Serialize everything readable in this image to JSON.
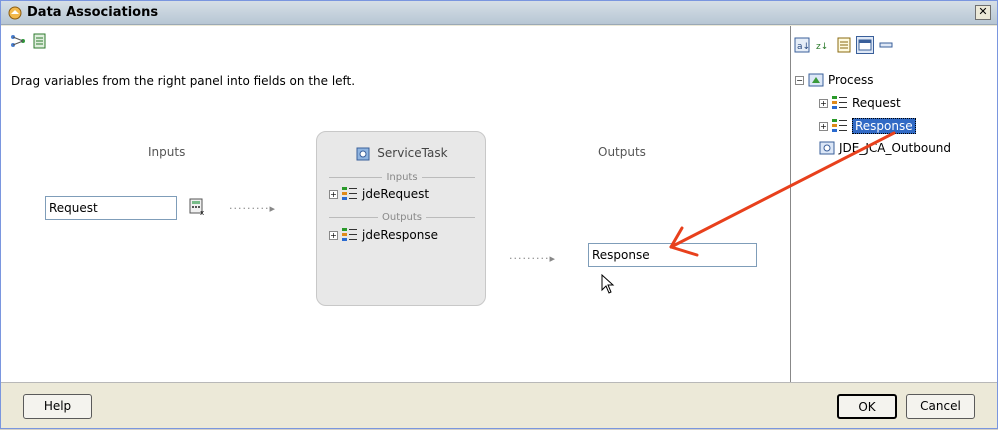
{
  "window": {
    "title": "Data Associations",
    "close_label": "✕"
  },
  "instructions": "Drag variables from the right panel into fields on the left.",
  "columns": {
    "inputs": "Inputs",
    "outputs": "Outputs"
  },
  "inputs": {
    "field_value": "Request"
  },
  "outputs": {
    "field_value": "Response"
  },
  "service_task": {
    "title": "ServiceTask",
    "inputs_section": "Inputs",
    "outputs_section": "Outputs",
    "input_item": "jdeRequest",
    "output_item": "jdeResponse"
  },
  "tree": {
    "root": "Process",
    "children": [
      "Request",
      "Response"
    ],
    "sibling": "JDE_JCA_Outbound"
  },
  "buttons": {
    "help": "Help",
    "ok": "OK",
    "cancel": "Cancel"
  },
  "colors": {
    "selection": "#316ac5",
    "arrow": "#e8401c",
    "panel_bg": "#ffffff"
  }
}
